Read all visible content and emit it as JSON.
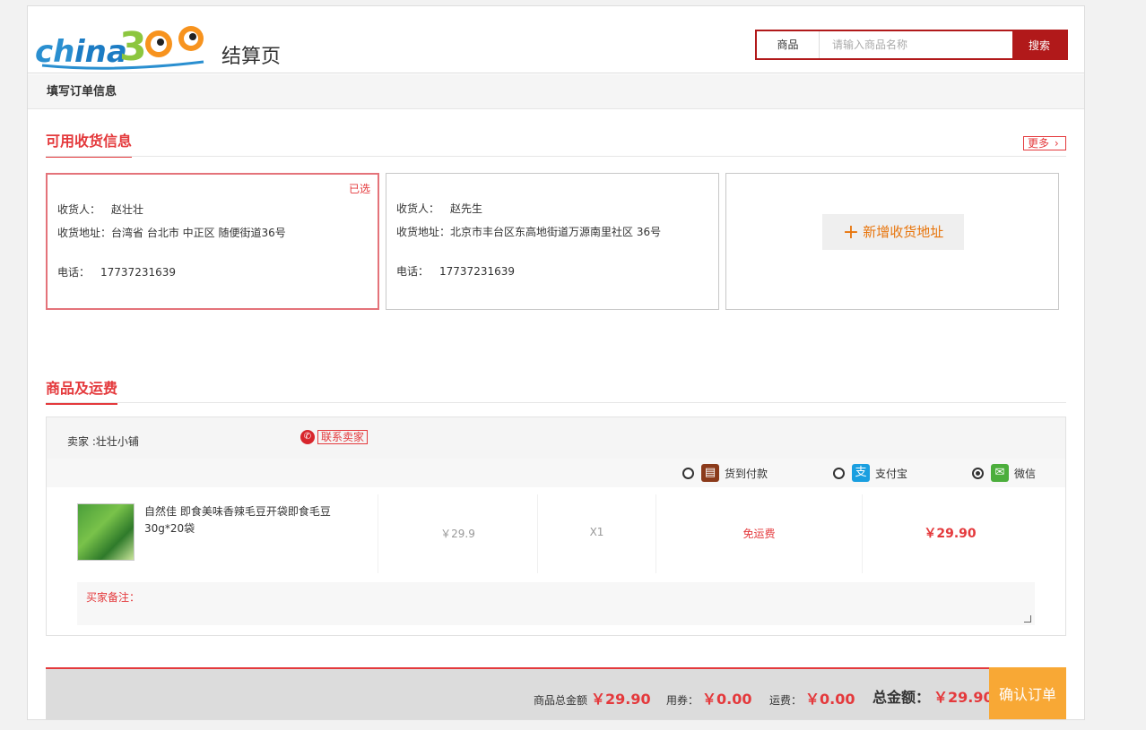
{
  "header": {
    "logo_text": "china369",
    "page_title": "结算页",
    "search": {
      "category": "商品",
      "placeholder": "请输入商品名称",
      "button": "搜索"
    }
  },
  "breadcrumb": "填写订单信息",
  "address_section": {
    "title": "可用收货信息",
    "more": "更多",
    "cards": [
      {
        "selected_badge": "已选",
        "receiver_label": "收货人：",
        "receiver": "赵壮壮",
        "address_label": "收货地址：",
        "address": "台湾省 台北市 中正区 随便街道36号",
        "phone_label": "电话：",
        "phone": "17737231639"
      },
      {
        "receiver_label": "收货人：",
        "receiver": "赵先生",
        "address_label": "收货地址：",
        "address": "北京市丰台区东高地街道万源南里社区 36号",
        "phone_label": "电话：",
        "phone": "17737231639"
      }
    ],
    "add_label": "新增收货地址"
  },
  "goods_section": {
    "title": "商品及运费",
    "seller": "卖家 :壮壮小铺",
    "contact": "联系卖家",
    "payment": [
      {
        "label": "货到付款",
        "icon": "wallet-icon",
        "selected": false,
        "color": "#8b3a1a"
      },
      {
        "label": "支付宝",
        "icon": "alipay-icon",
        "selected": false,
        "color": "#1a9fe0"
      },
      {
        "label": "微信",
        "icon": "wechat-icon",
        "selected": true,
        "color": "#4cae3c"
      }
    ],
    "product": {
      "name": "自然佳 即食美味香辣毛豆开袋即食毛豆30g*20袋",
      "price": "￥29.9",
      "qty": "X1",
      "shipping": "免运费",
      "subtotal": "￥29.90"
    },
    "remark_label": "买家备注："
  },
  "footer": {
    "goods_total_label": "商品总金额",
    "goods_total": "￥29.90",
    "coupon_label": "用券：",
    "coupon": "￥0.00",
    "shipping_label": "运费：",
    "shipping": "￥0.00",
    "total_label": "总金额：",
    "total": "￥29.90",
    "confirm": "确认订单"
  },
  "colors": {
    "accent": "#e4393c",
    "search_border": "#b1191a",
    "confirm_bg": "#f8a835",
    "add_text": "#e8750c"
  }
}
